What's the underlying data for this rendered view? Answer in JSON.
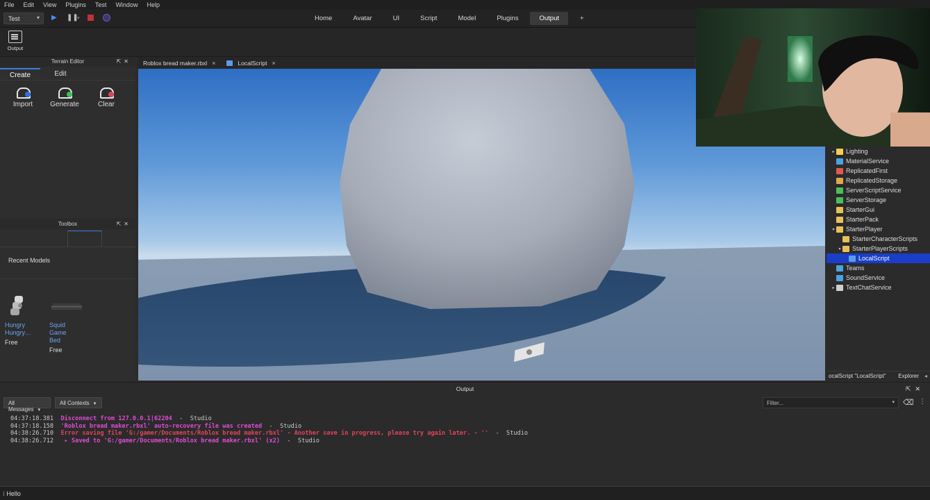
{
  "menu": [
    "File",
    "Edit",
    "View",
    "Plugins",
    "Test",
    "Window",
    "Help"
  ],
  "mode": {
    "value": "Test"
  },
  "ribbon_tabs": [
    {
      "label": "Home",
      "active": false
    },
    {
      "label": "Avatar",
      "active": false
    },
    {
      "label": "UI",
      "active": false
    },
    {
      "label": "Script",
      "active": false
    },
    {
      "label": "Model",
      "active": false
    },
    {
      "label": "Plugins",
      "active": false
    },
    {
      "label": "Output",
      "active": true
    },
    {
      "label": "+",
      "active": false
    }
  ],
  "ribbon_tools": {
    "output_label": "Output"
  },
  "terrain_editor": {
    "title": "Terrain Editor",
    "tabs": [
      "Create",
      "Edit"
    ],
    "tools": [
      {
        "label": "Import",
        "icon": "terrain-import-icon",
        "badge_color": "#2d6fe0"
      },
      {
        "label": "Generate",
        "icon": "terrain-generate-icon",
        "badge_color": "#3fbf5a"
      },
      {
        "label": "Clear",
        "icon": "terrain-clear-icon",
        "badge_color": "#e0445a"
      }
    ]
  },
  "toolbox": {
    "title": "Toolbox",
    "section": "Recent Models",
    "models": [
      {
        "name_line1": "Hungry",
        "name_line2": "Hungry…",
        "price": "Free"
      },
      {
        "name_line1": "Squid Game",
        "name_line2": "Bed",
        "price": "Free"
      }
    ]
  },
  "doc_tabs": [
    {
      "label": "Roblox bread maker.rbxl",
      "close": "×"
    },
    {
      "label": "LocalScript",
      "close": "×"
    }
  ],
  "explorer": {
    "items": [
      {
        "label": "Lighting",
        "indent": 0,
        "arrow": "▸",
        "icon_color": "#f2d14a",
        "selected": false
      },
      {
        "label": "MaterialService",
        "indent": 0,
        "arrow": "",
        "icon_color": "#4aa3e0",
        "selected": false
      },
      {
        "label": "ReplicatedFirst",
        "indent": 0,
        "arrow": "",
        "icon_color": "#e05a4a",
        "selected": false
      },
      {
        "label": "ReplicatedStorage",
        "indent": 0,
        "arrow": "",
        "icon_color": "#e0a84a",
        "selected": false
      },
      {
        "label": "ServerScriptService",
        "indent": 0,
        "arrow": "",
        "icon_color": "#4ac05a",
        "selected": false
      },
      {
        "label": "ServerStorage",
        "indent": 0,
        "arrow": "",
        "icon_color": "#4ac05a",
        "selected": false
      },
      {
        "label": "StarterGui",
        "indent": 0,
        "arrow": "",
        "icon_color": "#e8c05a",
        "selected": false
      },
      {
        "label": "StarterPack",
        "indent": 0,
        "arrow": "",
        "icon_color": "#e8c05a",
        "selected": false
      },
      {
        "label": "StarterPlayer",
        "indent": 0,
        "arrow": "▾",
        "icon_color": "#e8c05a",
        "selected": false
      },
      {
        "label": "StarterCharacterScripts",
        "indent": 1,
        "arrow": "",
        "icon_color": "#e8c05a",
        "selected": false
      },
      {
        "label": "StarterPlayerScripts",
        "indent": 1,
        "arrow": "▾",
        "icon_color": "#e8c05a",
        "selected": false
      },
      {
        "label": "LocalScript",
        "indent": 2,
        "arrow": "",
        "icon_color": "#5c9bea",
        "selected": true
      },
      {
        "label": "Teams",
        "indent": 0,
        "arrow": "",
        "icon_color": "#4aa3e0",
        "selected": false
      },
      {
        "label": "SoundService",
        "indent": 0,
        "arrow": "",
        "icon_color": "#4aa3e0",
        "selected": false
      },
      {
        "label": "TextChatService",
        "indent": 0,
        "arrow": "▸",
        "icon_color": "#cfcfcf",
        "selected": false
      }
    ],
    "footer_path": "ocalScript \"LocalScript\"",
    "footer_tab": "Explorer"
  },
  "output": {
    "title": "Output",
    "filter_messages": "All Messages",
    "filter_contexts": "All Contexts",
    "filter_placeholder": "Filter...",
    "lines": [
      {
        "ts": "04:37:18.381",
        "msg": "Disconnect from 127.0.0.1|62204",
        "src": "  -  Studio",
        "color": "magenta"
      },
      {
        "ts": "04:37:18.158",
        "msg": "'Roblox bread maker.rbxl' auto-recovery file was created",
        "src": "  -  Studio",
        "color": "magenta"
      },
      {
        "ts": "04:38:26.710",
        "msg": "Error saving file 'G:/gamer/Documents/Roblox bread maker.rbxl' - Another save in progress, please try again later. - ''",
        "src": "  -  Studio",
        "color": "red"
      },
      {
        "ts": "04:38:26.712",
        "msg": " ▸ Saved to 'G:/gamer/Documents/Roblox bread maker.rbxl' (x2)",
        "src": "  -  Studio",
        "color": "magenta"
      }
    ]
  },
  "command_bar": {
    "value": "Hello"
  }
}
